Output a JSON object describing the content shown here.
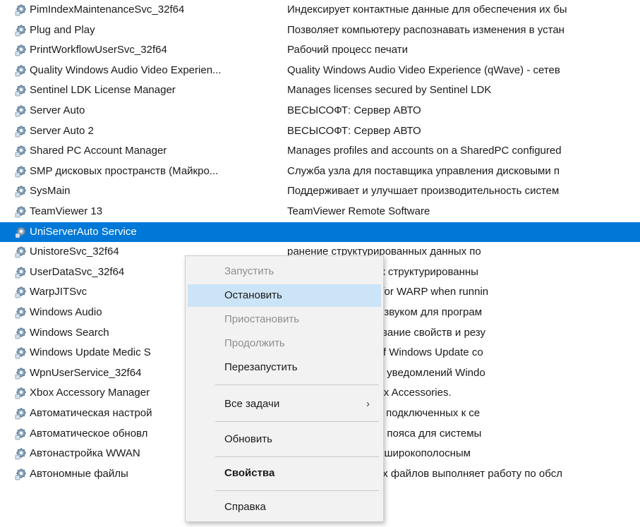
{
  "services": [
    {
      "name": "PimIndexMaintenanceSvc_32f64",
      "description": "Индексирует контактные данные для обеспечения их бы"
    },
    {
      "name": "Plug and Play",
      "description": "Позволяет компьютеру распознавать изменения в устан"
    },
    {
      "name": "PrintWorkflowUserSvc_32f64",
      "description": "Рабочий процесс печати"
    },
    {
      "name": "Quality Windows Audio Video Experien...",
      "description": "Quality Windows Audio Video Experience (qWave) - сетев"
    },
    {
      "name": "Sentinel LDK License Manager",
      "description": "Manages licenses secured by Sentinel LDK"
    },
    {
      "name": "Server Auto",
      "description": "ВЕСЫСОФТ: Сервер АВТО"
    },
    {
      "name": "Server Auto 2",
      "description": "ВЕСЫСОФТ: Сервер АВТО"
    },
    {
      "name": "Shared PC Account Manager",
      "description": "Manages profiles and accounts on a SharedPC configured"
    },
    {
      "name": "SMP дисковых пространств (Майкро...",
      "description": "Служба узла для поставщика управления дисковыми п"
    },
    {
      "name": "SysMain",
      "description": "Поддерживает и улучшает производительность систем"
    },
    {
      "name": "TeamViewer 13",
      "description": "TeamViewer Remote Software"
    },
    {
      "name": "UniServerAuto Service",
      "description": "",
      "selected": true
    },
    {
      "name": "UnistoreSvc_32f64",
      "description": "ранение структурированных данных по"
    },
    {
      "name": "UserDataSvc_32f64",
      "description": "оступ приложений к структурированны"
    },
    {
      "name": "WarpJITSvc",
      "description": "t of process service for WARP when runnin"
    },
    {
      "name": "Windows Audio",
      "description": "дствами работы со звуком для програм"
    },
    {
      "name": "Windows Search",
      "description": "е контента, кэширование свойств и резу"
    },
    {
      "name": "Windows Update Medic S",
      "description": "tion and protection of Windows Update co"
    },
    {
      "name": "WpnUserService_32f64",
      "description": "мещает платформу уведомлений Windo"
    },
    {
      "name": "Xbox Accessory Manager",
      "description": "ages connected Xbox Accessories."
    },
    {
      "name": "Автоматическая настрой",
      "description": "тической установки подключенных к се"
    },
    {
      "name": "Автоматическое обновл",
      "description": "настройка часового пояса для системы"
    },
    {
      "name": "Автонастройка WWAN",
      "description": "вляет мобильными широкополосным"
    },
    {
      "name": "Автономные файлы",
      "description": "Служба автономных файлов выполняет работу по обсл"
    }
  ],
  "context_menu": {
    "items": [
      {
        "label": "Запустить",
        "state": "disabled"
      },
      {
        "label": "Остановить",
        "state": "hover"
      },
      {
        "label": "Приостановить",
        "state": "disabled"
      },
      {
        "label": "Продолжить",
        "state": "disabled"
      },
      {
        "label": "Перезапустить",
        "state": "enabled"
      },
      {
        "label": "Все задачи",
        "state": "enabled",
        "submenu_arrow": "›"
      },
      {
        "label": "Обновить",
        "state": "enabled"
      },
      {
        "label": "Свойства",
        "state": "bold"
      },
      {
        "label": "Справка",
        "state": "enabled"
      }
    ]
  },
  "colors": {
    "selection": "#0078d7",
    "menu_hover": "#cce4f7",
    "menu_background": "#f2f2f2"
  }
}
